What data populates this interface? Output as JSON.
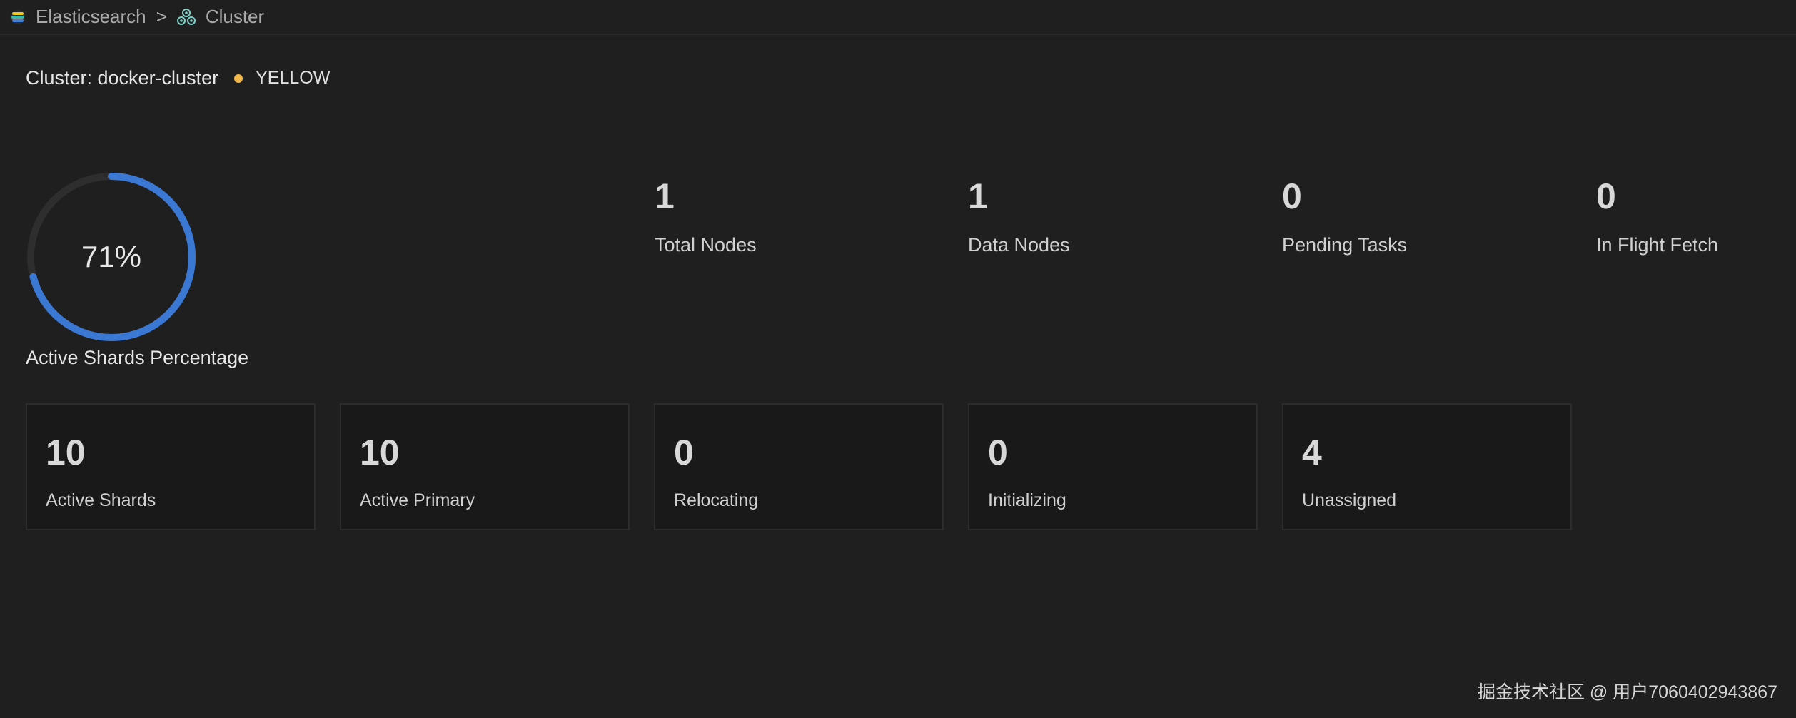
{
  "breadcrumb": {
    "items": [
      {
        "label": "Elasticsearch",
        "icon": "elasticsearch-icon"
      },
      {
        "label": "Cluster",
        "icon": "cluster-icon"
      }
    ],
    "separator": ">"
  },
  "cluster": {
    "title": "Cluster: docker-cluster",
    "status": "YELLOW",
    "status_color": "#f2b84b"
  },
  "active_shards_percentage": {
    "value_text": "71%",
    "value": 71,
    "label": "Active Shards Percentage",
    "ring_color": "#3a78d4",
    "track_color": "#2e2e2e"
  },
  "stats": [
    {
      "value": "1",
      "label": "Total Nodes"
    },
    {
      "value": "1",
      "label": "Data Nodes"
    },
    {
      "value": "0",
      "label": "Pending Tasks"
    },
    {
      "value": "0",
      "label": "In Flight Fetch"
    }
  ],
  "cards": [
    {
      "value": "10",
      "label": "Active Shards"
    },
    {
      "value": "10",
      "label": "Active Primary"
    },
    {
      "value": "0",
      "label": "Relocating"
    },
    {
      "value": "0",
      "label": "Initializing"
    },
    {
      "value": "4",
      "label": "Unassigned"
    }
  ],
  "watermark": "掘金技术社区 @ 用户7060402943867"
}
